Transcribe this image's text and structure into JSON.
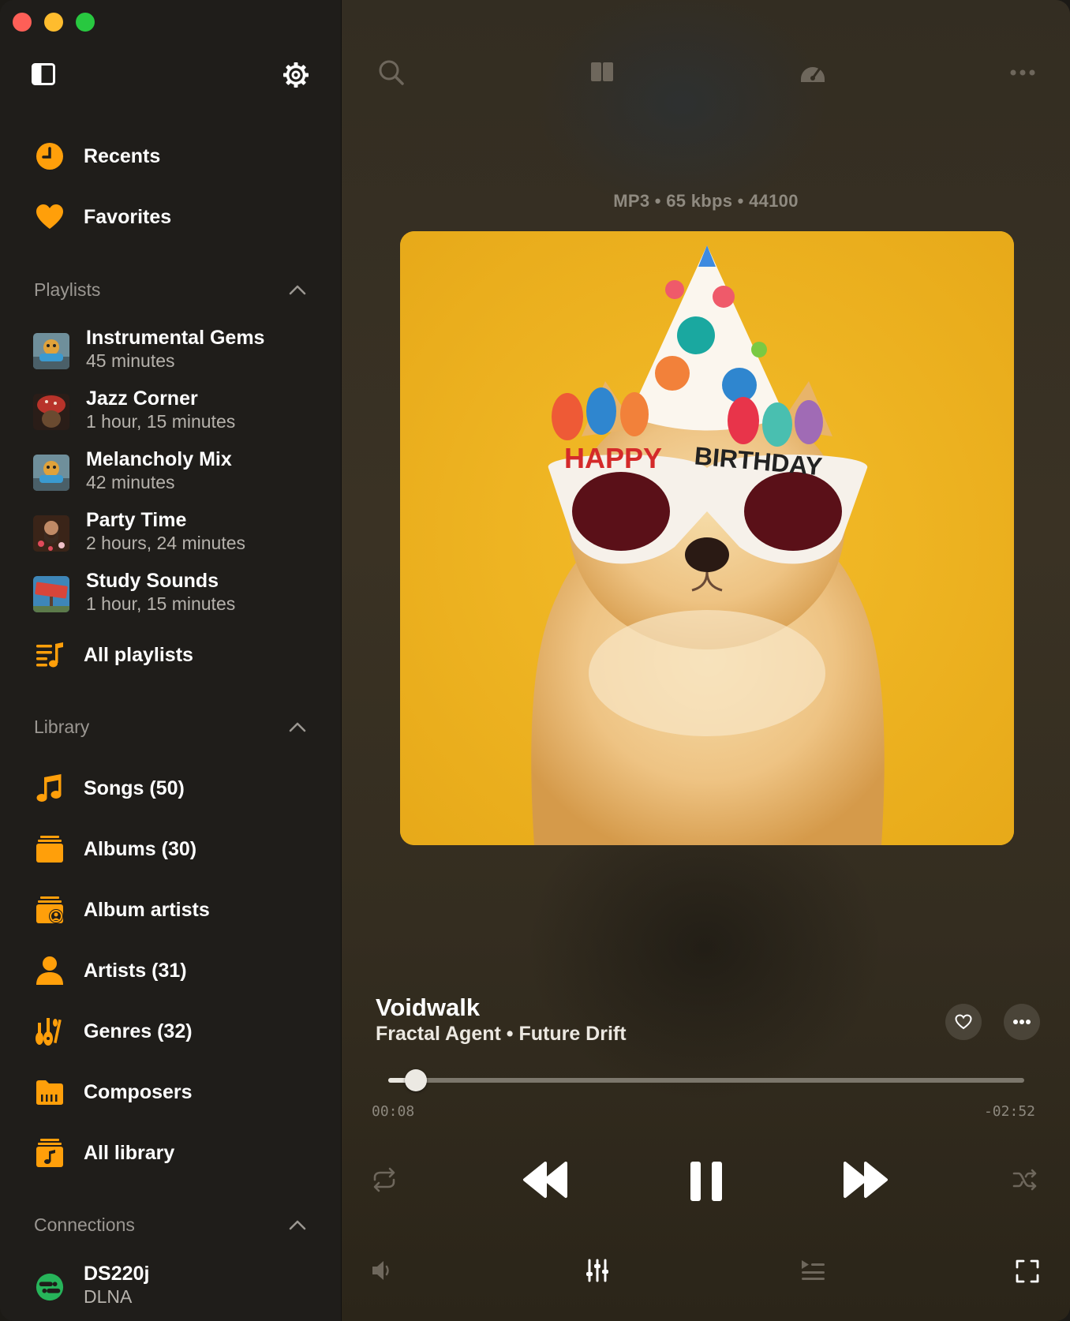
{
  "window": {
    "traffic_lights": [
      "close",
      "minimize",
      "zoom"
    ]
  },
  "sidebar": {
    "toggle_icon": "sidebar-toggle-icon",
    "settings_icon": "gear-icon",
    "top_items": [
      {
        "label": "Recents",
        "icon": "clock-icon"
      },
      {
        "label": "Favorites",
        "icon": "heart-icon"
      }
    ],
    "playlists_header": "Playlists",
    "playlists": [
      {
        "name": "Instrumental Gems",
        "duration": "45 minutes"
      },
      {
        "name": "Jazz Corner",
        "duration": "1 hour, 15 minutes"
      },
      {
        "name": "Melancholy Mix",
        "duration": "42 minutes"
      },
      {
        "name": "Party Time",
        "duration": "2 hours, 24 minutes"
      },
      {
        "name": "Study Sounds",
        "duration": "1 hour, 15 minutes"
      }
    ],
    "all_playlists": "All playlists",
    "library_header": "Library",
    "library": [
      {
        "label": "Songs (50)",
        "icon": "music-note-icon"
      },
      {
        "label": "Albums (30)",
        "icon": "albums-stack-icon"
      },
      {
        "label": "Album artists",
        "icon": "album-artist-icon"
      },
      {
        "label": "Artists (31)",
        "icon": "person-icon"
      },
      {
        "label": "Genres (32)",
        "icon": "guitars-icon"
      },
      {
        "label": "Composers",
        "icon": "piano-folder-icon"
      },
      {
        "label": "All library",
        "icon": "library-icon"
      }
    ],
    "connections_header": "Connections",
    "connection": {
      "name": "DS220j",
      "type": "DLNA"
    }
  },
  "player": {
    "format": "MP3 • 65 kbps • 44100",
    "artwork_text_left": "HAPPY",
    "artwork_text_right": "BIRTHDAY",
    "title": "Voidwalk",
    "subtitle": "Fractal Agent • Future Drift",
    "elapsed": "00:08",
    "remaining": "-02:52",
    "progress": 0.044
  },
  "colors": {
    "accent": "#ff9f0a",
    "sidebar_bg": "#1f1d1a",
    "artwork_bg": "#ebb21d"
  }
}
